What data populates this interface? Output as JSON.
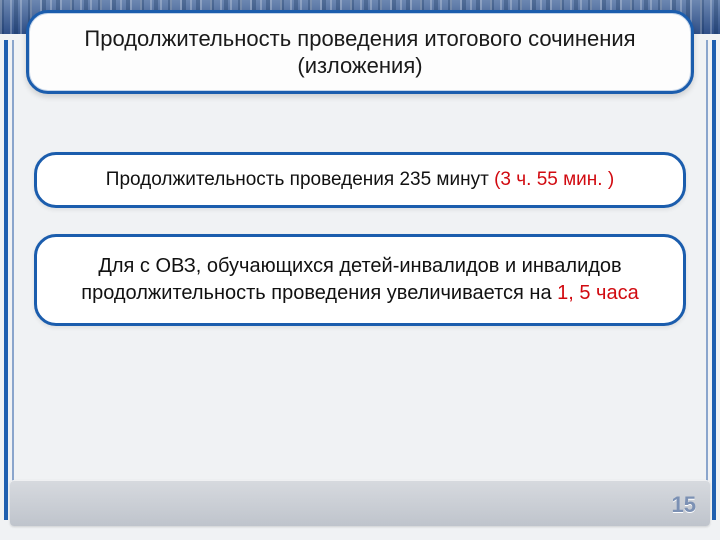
{
  "title": "Продолжительность проведения итогового сочинения (изложения)",
  "duration": {
    "prefix": "Продолжительность проведения 235 минут ",
    "highlight": "(3 ч. 55 мин. )"
  },
  "ovz": {
    "line1": "Для с ОВЗ, обучающихся детей-инвалидов и инвалидов",
    "line2_prefix": "продолжительность проведения увеличивается на ",
    "line2_highlight": "1, 5 часа"
  },
  "page_number": "15"
}
